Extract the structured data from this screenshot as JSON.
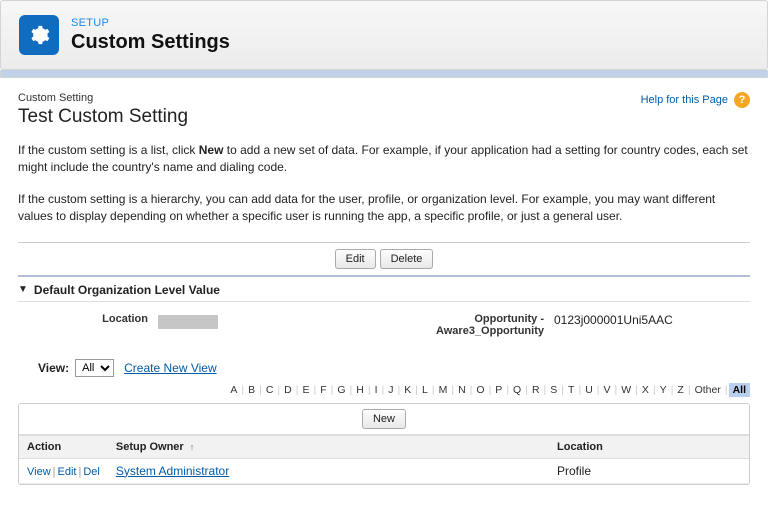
{
  "header": {
    "setup_label": "SETUP",
    "title": "Custom Settings",
    "icon": "gear"
  },
  "page": {
    "subtitle": "Custom Setting",
    "title": "Test Custom Setting",
    "help_link": "Help for this Page"
  },
  "desc1_pre": "If the custom setting is a list, click ",
  "desc1_bold": "New",
  "desc1_post": " to add a new set of data. For example, if your application had a setting for country codes, each set might include the country's name and dialing code.",
  "desc2": "If the custom setting is a hierarchy, you can add data for the user, profile, or organization level. For example, you may want different values to display depending on whether a specific user is running the app, a specific profile, or just a general user.",
  "buttons": {
    "edit": "Edit",
    "delete": "Delete",
    "new": "New"
  },
  "section": {
    "title": "Default Organization Level Value",
    "fields": {
      "location_label": "Location",
      "location_value": "",
      "opp_label": "Opportunity - Aware3_Opportunity",
      "opp_value": "0123j000001Uni5AAC"
    }
  },
  "view": {
    "label": "View:",
    "selected": "All",
    "options": [
      "All"
    ],
    "create_link": "Create New View"
  },
  "alpha": {
    "letters": [
      "A",
      "B",
      "C",
      "D",
      "E",
      "F",
      "G",
      "H",
      "I",
      "J",
      "K",
      "L",
      "M",
      "N",
      "O",
      "P",
      "Q",
      "R",
      "S",
      "T",
      "U",
      "V",
      "W",
      "X",
      "Y",
      "Z"
    ],
    "other": "Other",
    "all": "All",
    "selected": "All"
  },
  "table": {
    "headers": {
      "action": "Action",
      "owner": "Setup Owner",
      "location": "Location"
    },
    "actions": {
      "view": "View",
      "edit": "Edit",
      "del": "Del"
    },
    "rows": [
      {
        "owner": "System Administrator",
        "location": "Profile"
      }
    ]
  }
}
